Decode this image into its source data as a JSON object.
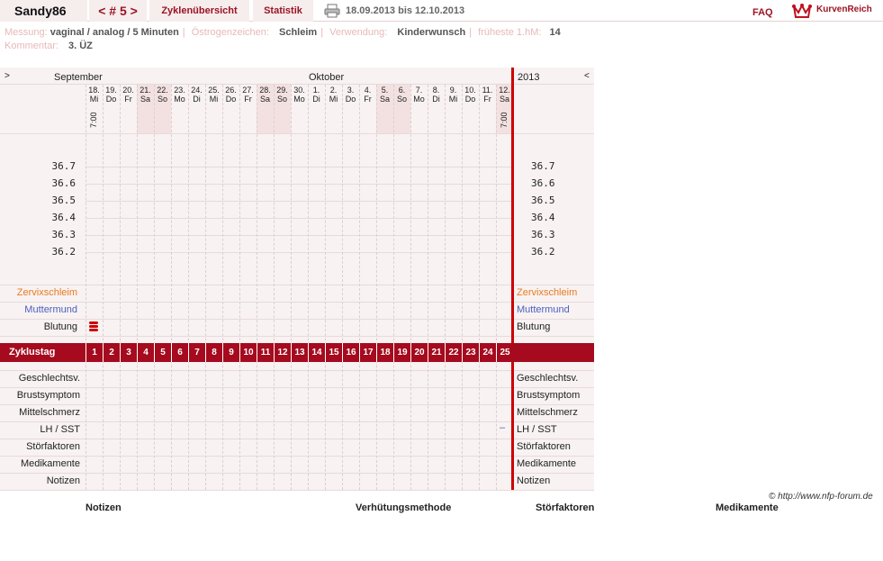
{
  "header": {
    "username": "Sandy86",
    "cycle_nav": "< # 5 >",
    "tab_overview": "Zyklenübersicht",
    "tab_stats": "Statistik",
    "date_range": "18.09.2013 bis 12.10.2013",
    "faq": "FAQ",
    "logo": "KurvenReich"
  },
  "info": {
    "messung_label": "Messung:",
    "messung_value": "vaginal / analog / 5 Minuten",
    "oestrogen_label": "Östrogenzeichen:",
    "oestrogen_value": "Schleim",
    "verwendung_label": "Verwendung:",
    "verwendung_value": "Kinderwunsch",
    "fhm_label": "früheste 1.hM:",
    "fhm_value": "14",
    "kommentar_label": "Kommentar:",
    "kommentar_value": "3. ÜZ"
  },
  "chart": {
    "prev_glyph": ">",
    "next_glyph": "<",
    "month1": "September",
    "month2": "Oktober",
    "year": "2013",
    "days": [
      {
        "d": "18.",
        "w": "Mi"
      },
      {
        "d": "19.",
        "w": "Do"
      },
      {
        "d": "20.",
        "w": "Fr"
      },
      {
        "d": "21.",
        "w": "Sa"
      },
      {
        "d": "22.",
        "w": "So"
      },
      {
        "d": "23.",
        "w": "Mo"
      },
      {
        "d": "24.",
        "w": "Di"
      },
      {
        "d": "25.",
        "w": "Mi"
      },
      {
        "d": "26.",
        "w": "Do"
      },
      {
        "d": "27.",
        "w": "Fr"
      },
      {
        "d": "28.",
        "w": "Sa"
      },
      {
        "d": "29.",
        "w": "So"
      },
      {
        "d": "30.",
        "w": "Mo"
      },
      {
        "d": "1.",
        "w": "Di"
      },
      {
        "d": "2.",
        "w": "Mi"
      },
      {
        "d": "3.",
        "w": "Do"
      },
      {
        "d": "4.",
        "w": "Fr"
      },
      {
        "d": "5.",
        "w": "Sa"
      },
      {
        "d": "6.",
        "w": "So"
      },
      {
        "d": "7.",
        "w": "Mo"
      },
      {
        "d": "8.",
        "w": "Di"
      },
      {
        "d": "9.",
        "w": "Mi"
      },
      {
        "d": "10.",
        "w": "Do"
      },
      {
        "d": "11.",
        "w": "Fr"
      },
      {
        "d": "12.",
        "w": "Sa"
      }
    ],
    "times": [
      {
        "day": 1,
        "t": "7:00"
      },
      {
        "day": 25,
        "t": "7:00"
      }
    ],
    "temps": [
      "36.7",
      "36.6",
      "36.5",
      "36.4",
      "36.3",
      "36.2"
    ],
    "row_cervix": "Zervixschleim",
    "row_mm": "Muttermund",
    "row_blood": "Blutung",
    "blood_icon": "blood-icon",
    "blood_day": 1,
    "cycle_label": "Zyklustag",
    "cycle_days": [
      "1",
      "2",
      "3",
      "4",
      "5",
      "6",
      "7",
      "8",
      "9",
      "10",
      "11",
      "12",
      "13",
      "14",
      "15",
      "16",
      "17",
      "18",
      "19",
      "20",
      "21",
      "22",
      "23",
      "24",
      "25"
    ],
    "bottom_rows": [
      "Geschlechtsv.",
      "Brustsymptom",
      "Mittelschmerz",
      "LH / SST",
      "Störfaktoren",
      "Medikamente",
      "Notizen"
    ],
    "lh_mark_day": 25,
    "lh_mark": "–",
    "colors": {
      "accent": "#a50a1e",
      "cervix": "#e87c1e",
      "mm": "#4a5fc0",
      "weekend": "#f3e1e1"
    }
  },
  "copyright": "© http://www.nfp-forum.de",
  "footer": {
    "notizen": "Notizen",
    "verhuetung": "Verhütungsmethode",
    "stoerfaktoren": "Störfaktoren",
    "medikamente": "Medikamente"
  }
}
